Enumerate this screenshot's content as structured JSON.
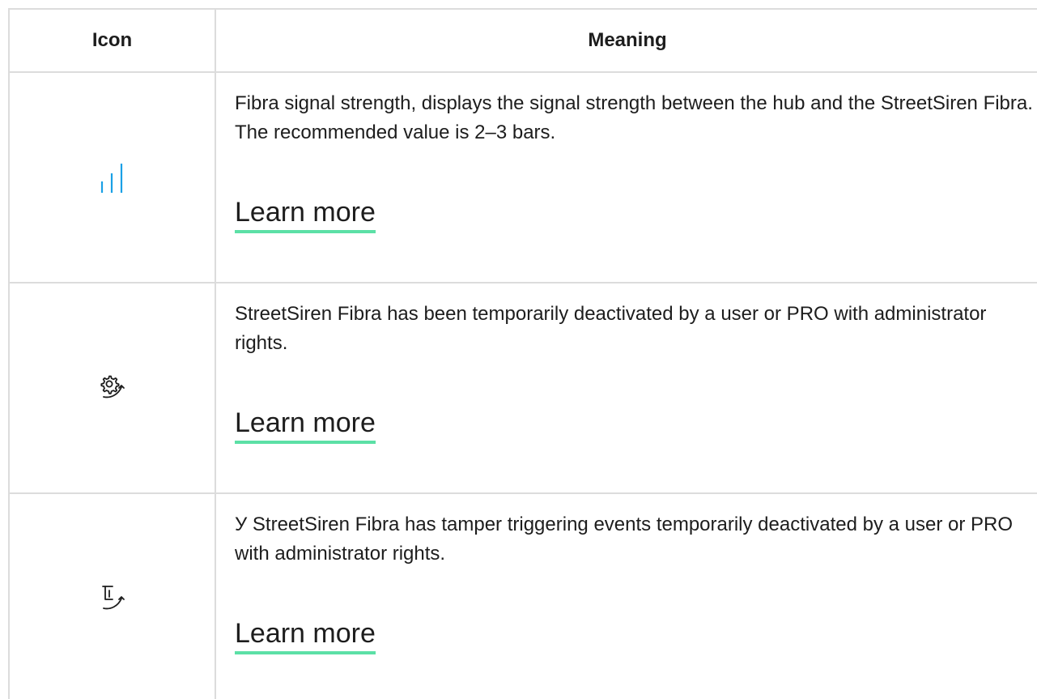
{
  "header": {
    "icon_col": "Icon",
    "meaning_col": "Meaning"
  },
  "rows": [
    {
      "icon": "signal-strength-icon",
      "icon_color": "#1aa0e6",
      "description": "Fibra signal strength, displays the signal strength between the hub and the StreetSiren Fibra. The recommended value is 2–3 bars.",
      "link": "Learn more"
    },
    {
      "icon": "gear-deactivated-icon",
      "description": "StreetSiren Fibra has been temporarily deactivated by a user or PRO with administrator rights.",
      "link": "Learn more"
    },
    {
      "icon": "tamper-deactivated-icon",
      "description": "У StreetSiren Fibra has tamper triggering events temporarily deactivated by a user or PRO with administrator rights.",
      "link": "Learn more"
    }
  ],
  "colors": {
    "link_underline": "#5ce0a6",
    "border": "#dcdcdc",
    "text": "#1d1d1d"
  }
}
